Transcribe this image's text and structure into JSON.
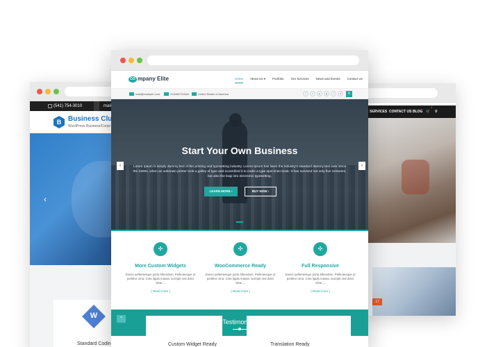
{
  "left_window": {
    "phone": "(541) 754-3010",
    "mail": "mail@",
    "brand_title": "Business Club",
    "brand_subtitle": "WordPress Business/Corpo",
    "slider_arrow": "‹",
    "feature_caption": "Standard Coding",
    "feature_icon": "wordpress-icon"
  },
  "right_window": {
    "nav": [
      "SERVICES",
      "CONTACT US",
      "BLOG"
    ],
    "cart_count": "1",
    "date_badge": "17"
  },
  "front_window": {
    "logo_prefix": "CO",
    "logo_text": "mpany Elite",
    "menu": [
      {
        "label": "Home",
        "active": true
      },
      {
        "label": "About Us ▾",
        "active": false
      },
      {
        "label": "Portfolio",
        "active": false
      },
      {
        "label": "Our Services",
        "active": false
      },
      {
        "label": "News and Events",
        "active": false
      },
      {
        "label": "Contact Us",
        "active": false
      }
    ],
    "info": {
      "email": "mail@example.com",
      "phone": "123456721548",
      "location": "United States of America"
    },
    "socials": [
      "f",
      "t",
      "p",
      "g",
      "i",
      "d",
      "in"
    ],
    "hero": {
      "title": "Start Your Own Business",
      "text": "Lorem Ipsum is simply dummy text of the printing and typesetting industry. Lorem Ipsum has been the industry's standard dummy text ever since the 1500s, when an unknown printer took a galley of type and scrambled it to make a type specimen book. It has survived not only five centuries, but also the leap into electronic typesetting.",
      "btn_more": "LEARN MORE ›",
      "btn_buy": "BUY NOW ›",
      "prev": "‹",
      "next": "›"
    },
    "features": [
      {
        "title": "More Custom Widgets",
        "text": "Donec pellentesque porta bibendum. Pellentesque ut porttitor urna. Cras ligula massa, suscipit sed dolor vitae,...",
        "link": "[ Read more ]"
      },
      {
        "title": "WooCommerce Ready",
        "text": "Donec pellentesque porta bibendum. Pellentesque ut porttitor urna. Cras ligula massa, suscipit sed dolor vitae,...",
        "link": "[ Read more ]"
      },
      {
        "title": "Full Responsive",
        "text": "Donec pellentesque porta bibendum. Pellentesque ut porttitor urna. Cras ligula massa, suscipit sed dolor vitae,...",
        "link": "[ Read more ]"
      }
    ],
    "testimonials_title": "Testimonials",
    "to_top": "^"
  },
  "bottom_captions": [
    "Custom Widget Ready",
    "Translation Ready"
  ],
  "colors": {
    "accent": "#1fa8a0",
    "brand_blue": "#1e73be"
  }
}
